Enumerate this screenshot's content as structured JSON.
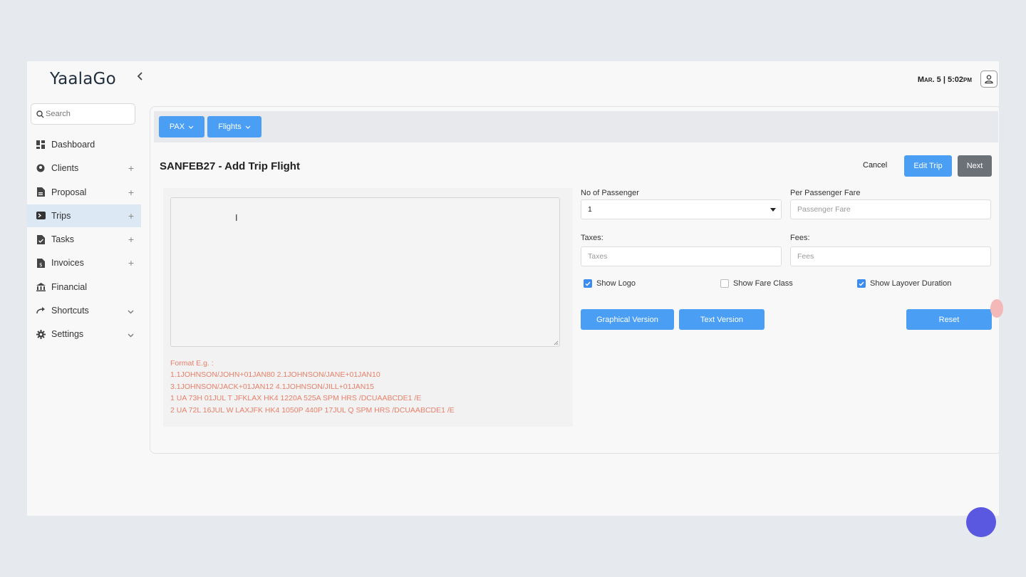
{
  "brand": "YaalaGo",
  "header": {
    "datetime": "Mar. 5 | 5:02pm"
  },
  "search": {
    "placeholder": "Search"
  },
  "sidebar": {
    "items": [
      {
        "label": "Dashboard",
        "icon": "dashboard-icon",
        "expand": ""
      },
      {
        "label": "Clients",
        "icon": "clients-icon",
        "expand": "+"
      },
      {
        "label": "Proposal",
        "icon": "proposal-icon",
        "expand": "+"
      },
      {
        "label": "Trips",
        "icon": "trips-icon",
        "expand": "+",
        "active": true
      },
      {
        "label": "Tasks",
        "icon": "tasks-icon",
        "expand": "+"
      },
      {
        "label": "Invoices",
        "icon": "invoices-icon",
        "expand": "+"
      },
      {
        "label": "Financial",
        "icon": "financial-icon",
        "expand": ""
      },
      {
        "label": "Shortcuts",
        "icon": "shortcuts-icon",
        "expand": "chevron"
      },
      {
        "label": "Settings",
        "icon": "settings-icon",
        "expand": "chevron"
      }
    ]
  },
  "toolbar": {
    "pax_label": "PAX",
    "flights_label": "Flights"
  },
  "page": {
    "title": "SANFEB27 - Add Trip Flight",
    "cancel_label": "Cancel",
    "edit_trip_label": "Edit Trip",
    "next_label": "Next"
  },
  "format": {
    "heading": "Format E.g. :",
    "lines": [
      "1.1JOHNSON/JOHN+01JAN80 2.1JOHNSON/JANE+01JAN10",
      "3.1JOHNSON/JACK+01JAN12 4.1JOHNSON/JILL+01JAN15",
      "1 UA 73H 01JUL T JFKLAX HK4 1220A 525A SPM HRS /DCUAABCDE1 /E",
      "2 UA 72L 16JUL W LAXJFK HK4 1050P 440P 17JUL Q SPM HRS /DCUAABCDE1 /E"
    ]
  },
  "form": {
    "passenger_label": "No of Passenger",
    "passenger_value": "1",
    "fare_label": "Per Passenger Fare",
    "fare_placeholder": "Passenger Fare",
    "taxes_label": "Taxes:",
    "taxes_placeholder": "Taxes",
    "fees_label": "Fees:",
    "fees_placeholder": "Fees",
    "show_logo_label": "Show Logo",
    "show_logo": true,
    "show_fare_class_label": "Show Fare Class",
    "show_fare_class": false,
    "show_layover_label": "Show Layover Duration",
    "show_layover": true,
    "graphical_label": "Graphical Version",
    "text_label": "Text Version",
    "reset_label": "Reset"
  },
  "colors": {
    "accent": "#4a9ff5",
    "next": "#6c7178",
    "format_text": "#e8806a",
    "active_nav": "#dde8f5"
  }
}
